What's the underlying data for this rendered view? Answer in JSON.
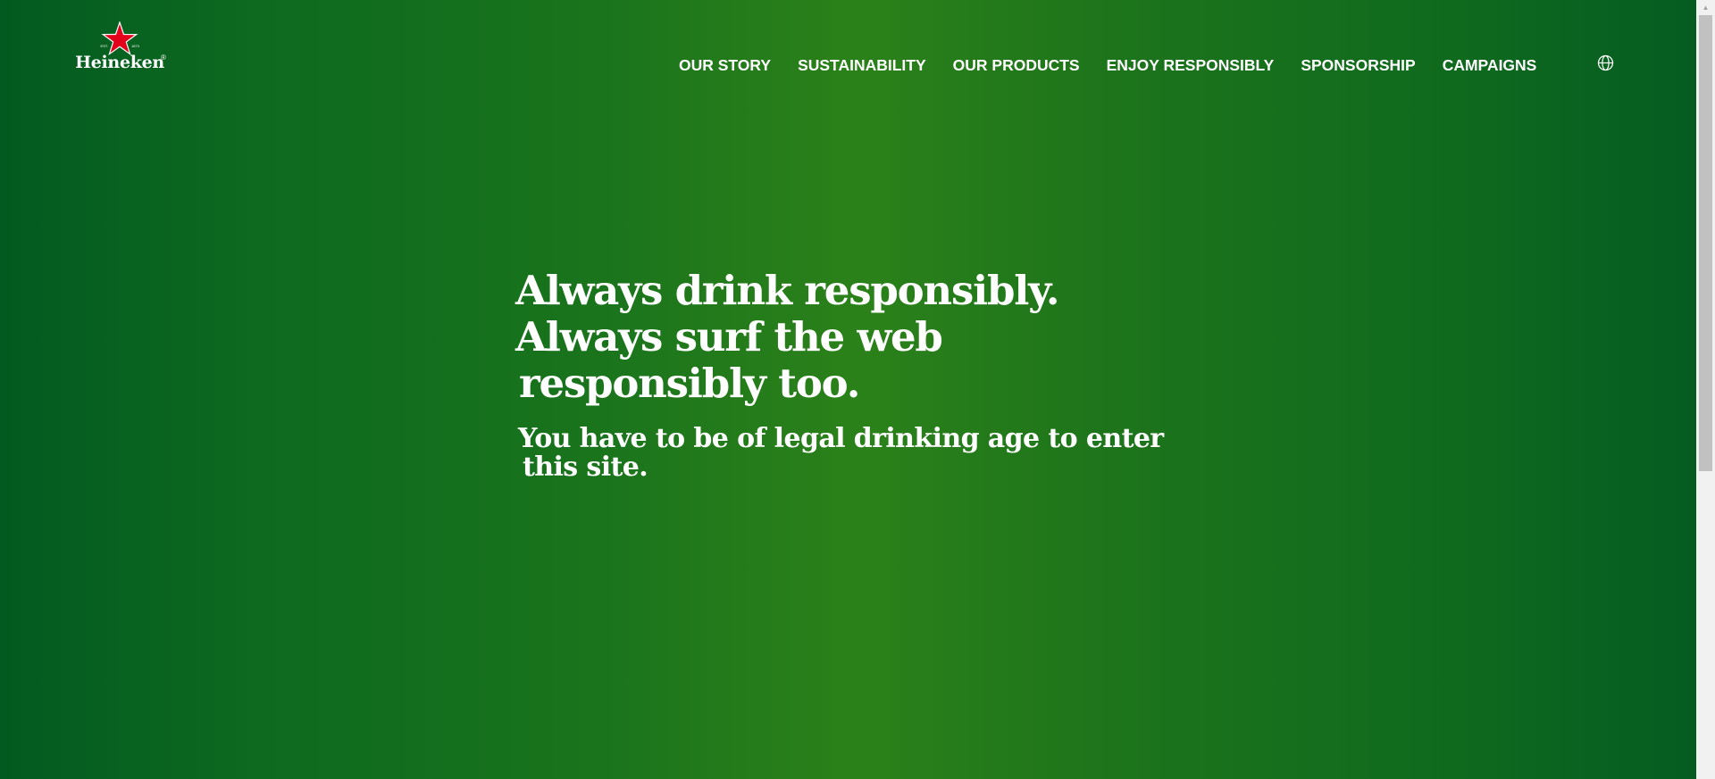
{
  "brand": {
    "name": "Heineken",
    "est_left": "EST.",
    "est_right": "1873"
  },
  "nav": {
    "items": [
      {
        "label": "OUR STORY"
      },
      {
        "label": "SUSTAINABILITY"
      },
      {
        "label": "OUR PRODUCTS"
      },
      {
        "label": "ENJOY RESPONSIBLY"
      },
      {
        "label": "SPONSORSHIP"
      },
      {
        "label": "CAMPAIGNS"
      }
    ],
    "language_icon": "globe-icon"
  },
  "hero": {
    "headline_lines": [
      "Always drink responsibly.",
      "Always surf the web",
      "responsibly too."
    ],
    "subline_lines": [
      "You have to be of legal drinking age to enter",
      "this site."
    ]
  },
  "colors": {
    "brand_green_dark": "#035a20",
    "brand_green_light": "#2b8119",
    "star_red": "#e3001b",
    "text": "#ffffff"
  }
}
